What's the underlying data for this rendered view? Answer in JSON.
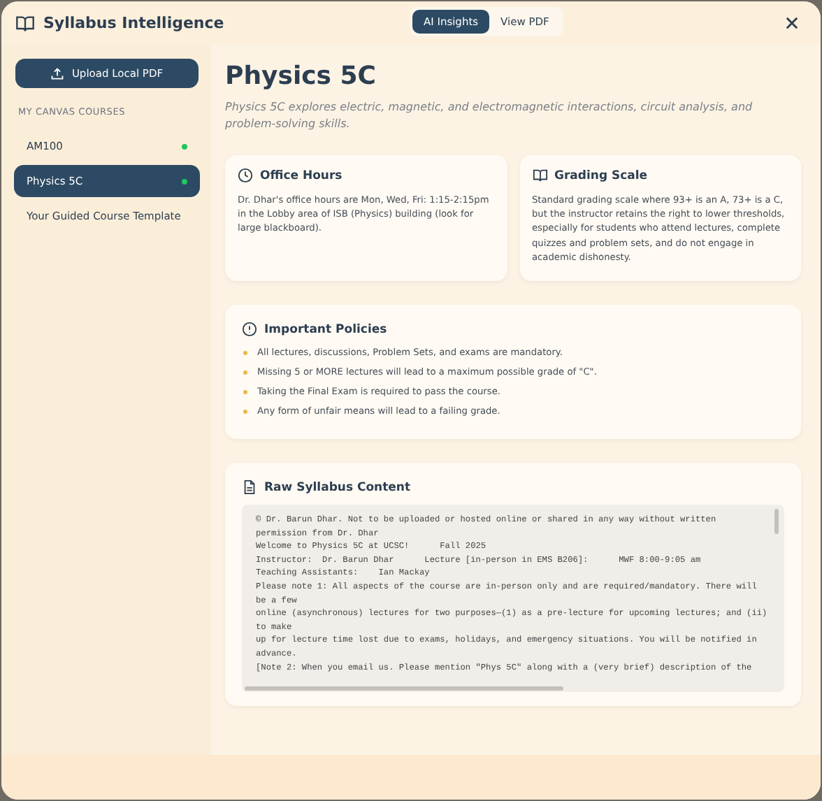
{
  "app": {
    "title": "Syllabus Intelligence"
  },
  "view_tabs": [
    {
      "label": "AI Insights",
      "selected": true
    },
    {
      "label": "View PDF",
      "selected": false
    }
  ],
  "sidebar": {
    "upload_button": "Upload Local PDF",
    "section_heading": "MY CANVAS COURSES",
    "items": [
      {
        "label": "AM100",
        "selected": false,
        "status_dot": true
      },
      {
        "label": "Physics 5C",
        "selected": true,
        "status_dot": true
      },
      {
        "label": "Your Guided Course Template",
        "selected": false,
        "status_dot": false
      }
    ]
  },
  "course": {
    "title": "Physics 5C",
    "description": "Physics 5C explores electric, magnetic, and electromagnetic interactions, circuit analysis, and problem-solving skills."
  },
  "cards": [
    {
      "kind": "clock",
      "title": "Office Hours",
      "body": "Dr. Dhar's office hours are Mon, Wed, Fri: 1:15-2:15pm in the Lobby area of ISB (Physics) building (look for large blackboard)."
    },
    {
      "kind": "book",
      "title": "Grading Scale",
      "body": "Standard grading scale where 93+ is an A, 73+ is a C, but the instructor retains the right to lower thresholds, especially for students who attend lectures, complete quizzes and problem sets, and do not engage in academic dishonesty."
    }
  ],
  "policies": {
    "title": "Important Policies",
    "items": [
      "All lectures, discussions, Problem Sets, and exams are mandatory.",
      "Missing 5 or MORE lectures will lead to a maximum possible grade of \"C\".",
      "Taking the Final Exam is required to pass the course.",
      "Any form of unfair means will lead to a failing grade."
    ]
  },
  "raw": {
    "title": "Raw Syllabus Content",
    "lines": [
      "© Dr. Barun Dhar. Not to be uploaded or hosted online or shared in any way without written",
      "permission from Dr. Dhar",
      "Welcome to Physics 5C at UCSC!      Fall 2025",
      "Instructor:  Dr. Barun Dhar      Lecture [in-person in EMS B206]:      MWF 8:00-9:05 am",
      "Teaching Assistants:    Ian Mackay",
      "Please note 1: All aspects of the course are in-person only and are required/mandatory. There will",
      "be a few",
      "online (asynchronous) lectures for two purposes—(1) as a pre-lecture for upcoming lectures; and (ii)",
      "to make",
      "up for lecture time lost due to exams, holidays, and emergency situations. You will be notified in",
      "advance.",
      "[Note 2: When you email us. Please mention \"Phys 5C\" along with a (very brief) description of the"
    ]
  }
}
